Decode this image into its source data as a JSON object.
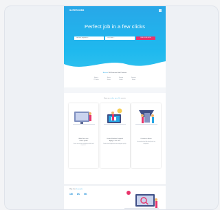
{
  "header": {
    "logo": "SUPERJOBS"
  },
  "hero": {
    "title": "Perfect job in a few clicks",
    "search_placeholder_1": "Job title, keywords...",
    "search_placeholder_2": "City, state...",
    "search_button": "FIND JOBS NOW"
  },
  "stats": {
    "heading_hl": "Browse",
    "heading_rest": " 500 Featured Job Positions",
    "items": [
      {
        "value": "New in",
        "label": "IT Roles"
      },
      {
        "value": "Sales",
        "label": "Roles"
      },
      {
        "value": "Design",
        "label": "Roles"
      },
      {
        "value": "Service",
        "label": "Roles"
      }
    ]
  },
  "how": {
    "heading_pre": "How we ",
    "heading_hl": "make your life",
    "heading_post": " easier",
    "steps": [
      {
        "title": "Build Your own",
        "title2": "Online profile",
        "desc": "Create an account and add your skills and experience."
      },
      {
        "title": "Create Flawless Proposal",
        "title2": "Apply in one click",
        "desc": "Send tailored applications to employers quickly."
      },
      {
        "title": "Connect to Hirers",
        "title2": "",
        "desc": "Get matched and talk directly with top companies."
      }
    ]
  },
  "lower": {
    "heading_pre": "Why ",
    "heading_mid": "Join ",
    "heading_hl": "Superjobs",
    "stats": [
      "1M",
      "1K",
      "5K"
    ]
  },
  "colors": {
    "hero": "#1fb9ee",
    "accent": "#e8336a",
    "link": "#27a7e5"
  }
}
